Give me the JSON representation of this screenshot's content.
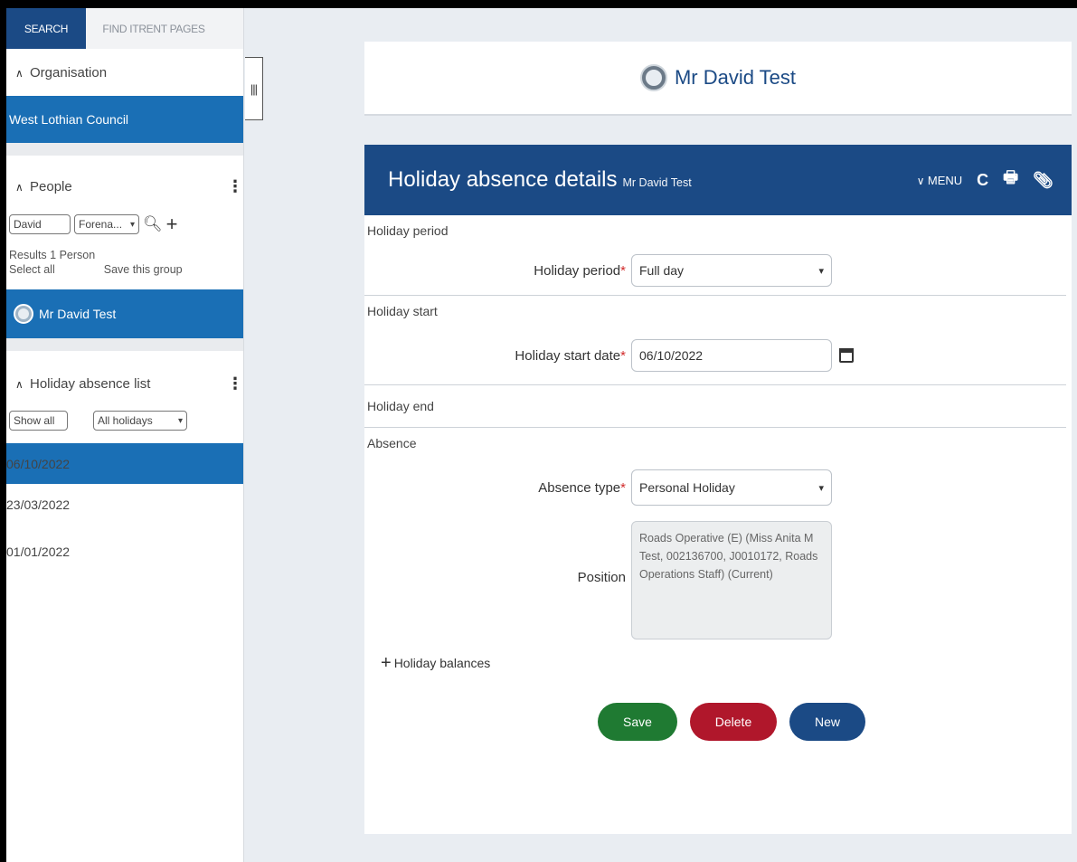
{
  "sidebar": {
    "tabs": [
      {
        "label": "SEARCH"
      },
      {
        "label": "FIND ITRENT PAGES"
      }
    ],
    "organisation": {
      "header": "Organisation",
      "selected": "West Lothian Council"
    },
    "people": {
      "header": "People",
      "search_value": "David",
      "search_field": "Forena...",
      "results": "Results 1 Person",
      "select_all": "Select all",
      "save_group": "Save this group",
      "selected_person": "Mr David Test"
    },
    "holiday_list": {
      "header": "Holiday absence list",
      "show_all": "Show all",
      "filter": "All holidays",
      "items": [
        {
          "label": "06/10/2022"
        },
        {
          "label": "23/03/2022"
        },
        {
          "label": "01/01/2022"
        }
      ]
    }
  },
  "person_card": {
    "name": "Mr David Test"
  },
  "panel": {
    "title": "Holiday absence details",
    "subtitle": "Mr David Test",
    "menu_label": "MENU",
    "sections": {
      "period": "Holiday period",
      "start": "Holiday start",
      "end": "Holiday end",
      "absence": "Absence"
    },
    "fields": {
      "period_label": "Holiday period",
      "period_value": "Full day",
      "start_label": "Holiday start date",
      "start_value": "06/10/2022",
      "absence_type_label": "Absence type",
      "absence_type_value": "Personal Holiday",
      "position_label": "Position",
      "position_value": "Roads Operative (E) (Miss Anita M Test, 002136700, J0010172, Roads Operations Staff) (Current)"
    },
    "balances_label": "Holiday balances",
    "buttons": {
      "save": "Save",
      "delete": "Delete",
      "new": "New"
    }
  },
  "colors": {
    "header_blue": "#1b4a85",
    "selected_blue": "#1a6fb5",
    "save_green": "#1f7a32",
    "delete_red": "#b0172b",
    "required_red": "#d12b2b"
  },
  "icons": {
    "refresh": "refresh-icon",
    "print": "print-icon",
    "attach": "paperclip-icon",
    "calendar": "calendar-icon",
    "search": "search-icon",
    "add": "plus-icon"
  }
}
